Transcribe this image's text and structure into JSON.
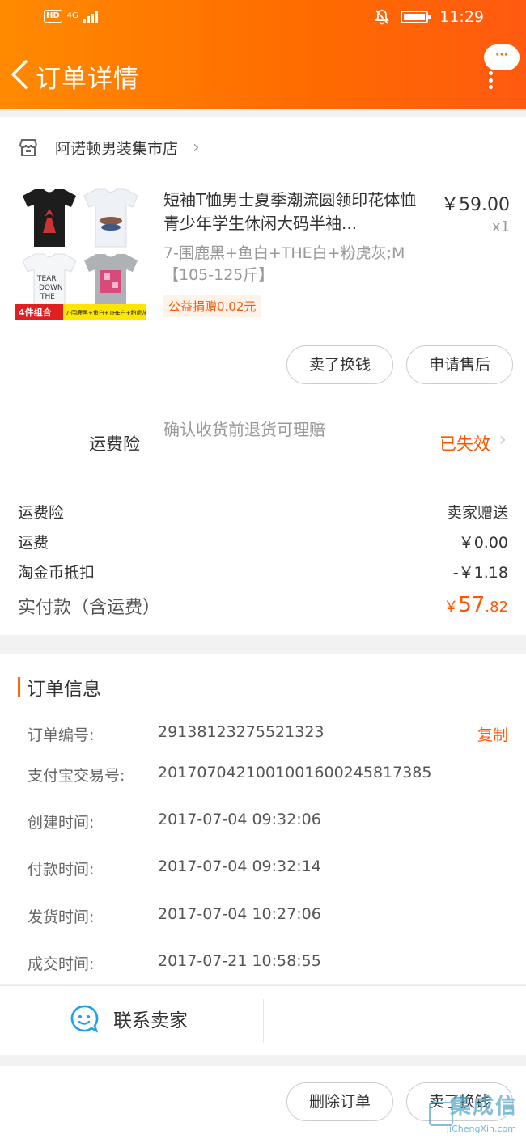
{
  "status_bar": {
    "network": "4G",
    "hd": "HD",
    "time": "11:29"
  },
  "header": {
    "title": "订单详情",
    "more_label": "···"
  },
  "store": {
    "name": "阿诺顿男装集市店"
  },
  "product": {
    "title": "短袖T恤男士夏季潮流圆领印花体恤青少年学生休闲大码半袖...",
    "price": "￥59.00",
    "quantity": "x1",
    "sku": "7-围鹿黑+鱼白+THE白+粉虎灰;M【105-125斤】",
    "charity": "公益捐赠0.02元",
    "thumb_badge": "4件组合",
    "thumb_caption": "7-围鹿黑+鱼白+THE白+粉虎灰"
  },
  "actions": {
    "exchange": "卖了换钱",
    "after_sales": "申请售后"
  },
  "insurance": {
    "label": "运费险",
    "desc": "确认收货前退货可理赔",
    "status": "已失效"
  },
  "costs": [
    {
      "label": "运费险",
      "value": "卖家赠送"
    },
    {
      "label": "运费",
      "value": "￥0.00"
    },
    {
      "label": "淘金币抵扣",
      "value": "-￥1.18"
    }
  ],
  "paid": {
    "label": "实付款（含运费）",
    "currency": "￥",
    "integer": "57",
    "decimal": ".82"
  },
  "order_info": {
    "title": "订单信息",
    "copy_label": "复制",
    "items": [
      {
        "label": "订单编号:",
        "value": "29138123275521323"
      },
      {
        "label": "支付宝交易号:",
        "value": "2017070421001001600245817385"
      },
      {
        "label": "创建时间:",
        "value": "2017-07-04 09:32:06"
      },
      {
        "label": "付款时间:",
        "value": "2017-07-04 09:32:14"
      },
      {
        "label": "发货时间:",
        "value": "2017-07-04 10:27:06"
      },
      {
        "label": "成交时间:",
        "value": "2017-07-21 10:58:55"
      }
    ]
  },
  "contact": {
    "label": "联系卖家"
  },
  "footer": {
    "delete": "删除订单",
    "exchange": "卖了换钱"
  },
  "watermark": {
    "text": "集成信",
    "sub": "JiChengXin.com"
  },
  "colors": {
    "accent": "#ff5500",
    "header_start": "#ff8a00",
    "header_end": "#ff5a10"
  }
}
